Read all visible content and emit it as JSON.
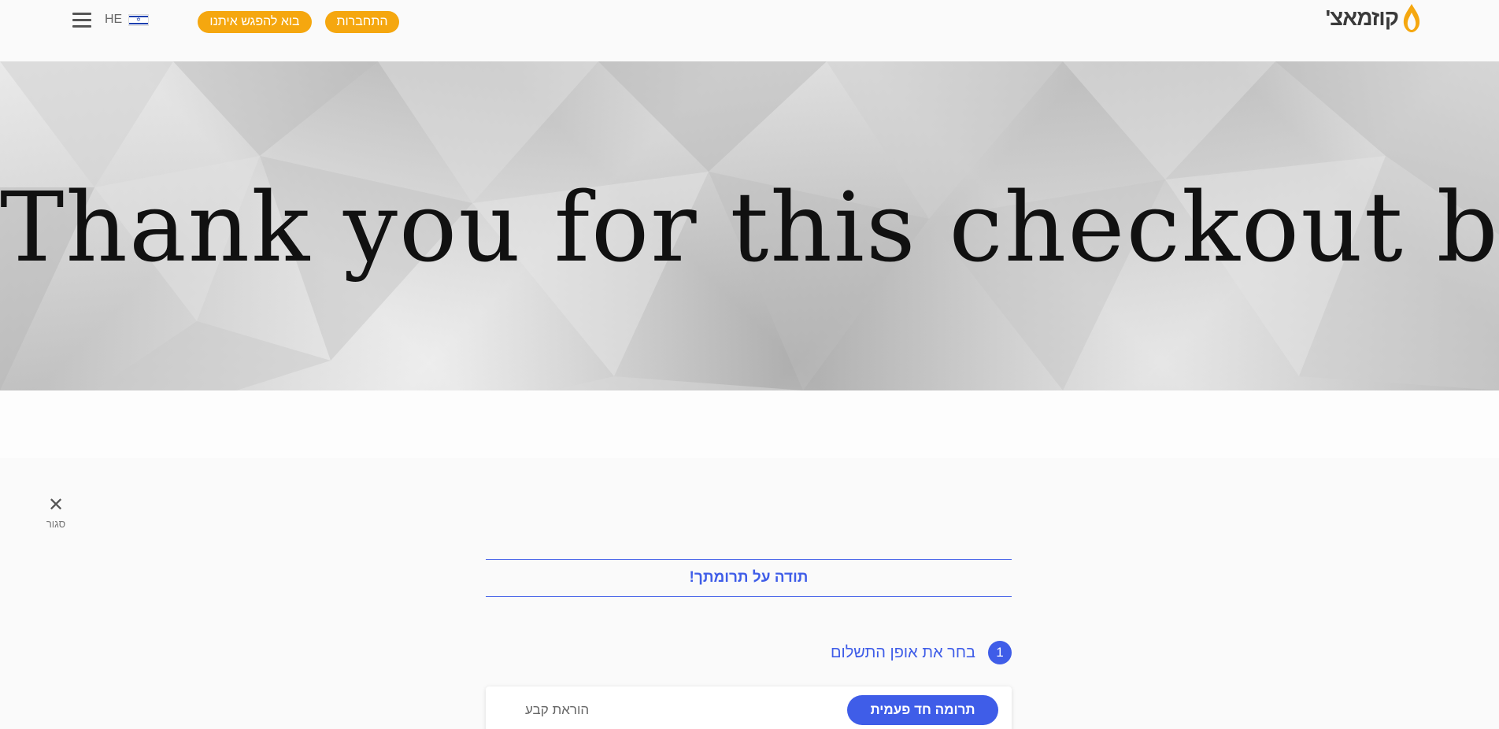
{
  "header": {
    "logo_text": "קוזמאצ'",
    "language": "HE",
    "login_label": "התחברות",
    "meet_label": "בוא להפגש איתנו",
    "menu_icon": "hamburger-menu-icon",
    "flag_icon": "israel-flag-icon",
    "brand_color": "#f5a70f"
  },
  "banner": {
    "text": "Thank you for this checkout banner!"
  },
  "close": {
    "label": "סגור",
    "icon": "close-icon"
  },
  "thanks": {
    "title": "תודה על תרומתך!"
  },
  "step1": {
    "number": "1",
    "label": "בחר את אופן התשלום",
    "accent_color": "#3f5de8"
  },
  "payment": {
    "one_time_label": "תרומה חד פעמית",
    "standing_order_label": "הוראת קבע"
  }
}
